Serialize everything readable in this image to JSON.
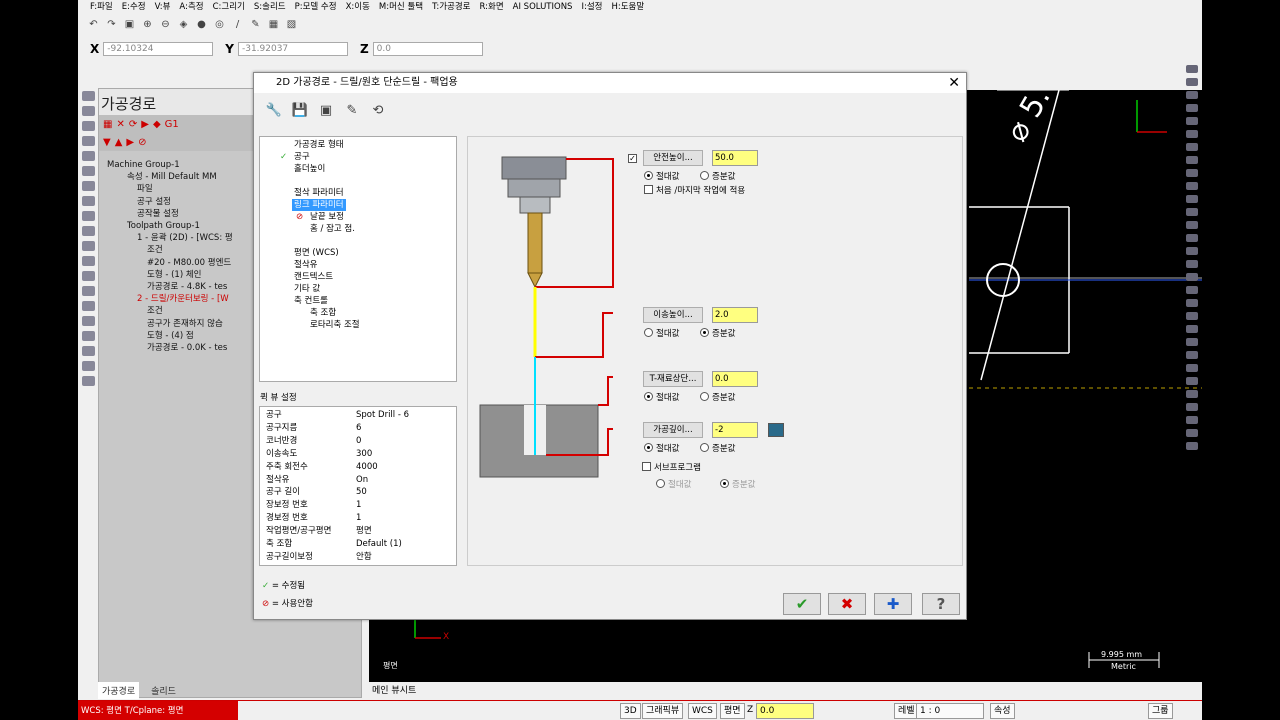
{
  "menu": [
    "F:파일",
    "E:수정",
    "V:뷰",
    "A:측정",
    "C:그리기",
    "S:솔리드",
    "P:모델 수정",
    "X:이동",
    "M:머신 툴택",
    "T:가공경로",
    "R:화면",
    "AI SOLUTIONS",
    "I:설정",
    "H:도움말"
  ],
  "coords": {
    "x_label": "X",
    "x_value": "-92.10324",
    "y_label": "Y",
    "y_value": "-31.92037",
    "z_label": "Z",
    "z_value": "0.0"
  },
  "panel": {
    "title": "가공경로",
    "tree": [
      "Machine Group-1",
      "속성 - Mill Default MM",
      "파일",
      "공구 설정",
      "공작물 설정",
      "Toolpath Group-1",
      "1 - 윤곽 (2D) - [WCS: 평",
      "조건",
      "#20 - M80.00 평엔드",
      "도형 - (1) 체인",
      "가공경로 - 4.8K - tes",
      "2 - 드릴/카운터보링 - [W",
      "조건",
      "공구가 존재하지 않습",
      "도형 - (4) 점",
      "가공경로 - 0.0K - tes"
    ],
    "tabs": [
      "가공경로",
      "솔리드"
    ]
  },
  "graphics": {
    "tab": "메인 뷰시트",
    "view": "평면",
    "scale_value": "9.995 mm",
    "scale_unit": "Metric",
    "ucs_x": "X"
  },
  "status": {
    "wcs": "WCS: 평면  T/Cplane: 평면",
    "3d": "3D",
    "gview": "그래픽뷰",
    "wcs_btn": "WCS",
    "plane": "평면",
    "z": "Z",
    "z_value": "0.0",
    "level_label": "레벨",
    "level_value": "1 : 0",
    "attr": "속성",
    "group": "그룹"
  },
  "dialog": {
    "title": "2D 가공경로 - 드릴/원호 단순드릴 - 팩업용",
    "nav": [
      "가공경로 형태",
      "공구",
      "홀더높이",
      "절삭 파라미터",
      "링크 파라미터",
      "날끝 보정",
      "홈 / 잠고 점.",
      "평면 (WCS)",
      "절삭유",
      "캔드텍스트",
      "기타 값",
      "축 컨트롤",
      "축 조합",
      "로타리축 조절"
    ],
    "quickview_title": "퀵 뷰 설정",
    "quickview": [
      {
        "k": "공구",
        "v": "Spot Drill - 6"
      },
      {
        "k": "공구지름",
        "v": "6"
      },
      {
        "k": "코너반경",
        "v": "0"
      },
      {
        "k": "이송속도",
        "v": "300"
      },
      {
        "k": "주축 회전수",
        "v": "4000"
      },
      {
        "k": "절삭유",
        "v": "On"
      },
      {
        "k": "공구 길이",
        "v": "50"
      },
      {
        "k": "장보정 번호",
        "v": "1"
      },
      {
        "k": "경보정 번호",
        "v": "1"
      },
      {
        "k": "작업평면/공구평면",
        "v": "평면"
      },
      {
        "k": "축 조합",
        "v": "Default (1)"
      },
      {
        "k": "공구길이보정",
        "v": "안함"
      }
    ],
    "legend_edited": "= 수정됨",
    "legend_disabled": "= 사용안함",
    "clearance": {
      "label": "안전높이...",
      "value": "50.0",
      "abs": "절대값",
      "inc": "증분값",
      "first_last": "처음 /마지막 작업에 적용"
    },
    "retract": {
      "label": "이송높이...",
      "value": "2.0",
      "abs": "절대값",
      "inc": "증분값"
    },
    "top": {
      "label": "T-재료상단...",
      "value": "0.0",
      "abs": "절대값",
      "inc": "증분값"
    },
    "depth": {
      "label": "가공깊이...",
      "value": "-2",
      "abs": "절대값",
      "inc": "증분값"
    },
    "subprogram": {
      "label": "서브프로그램",
      "abs": "절대값",
      "inc": "증분값"
    }
  },
  "colors": {
    "yellow_field": "#ffff80",
    "statusbar_red": "#d40000",
    "link_red": "#d40000"
  }
}
